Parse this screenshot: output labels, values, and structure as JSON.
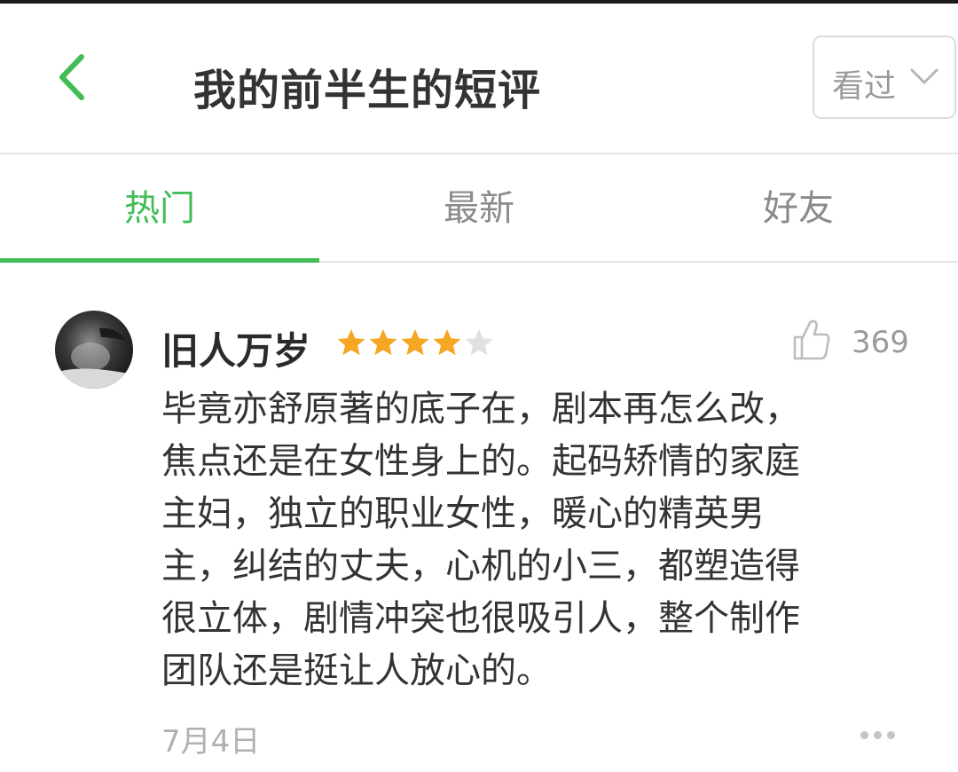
{
  "header": {
    "title": "我的前半生的短评",
    "filter_label": "看过",
    "back_icon": "chevron-left-icon",
    "filter_icon": "chevron-down-icon"
  },
  "tabs": [
    {
      "label": "热门",
      "active": true
    },
    {
      "label": "最新",
      "active": false
    },
    {
      "label": "好友",
      "active": false
    }
  ],
  "colors": {
    "accent": "#42bd56",
    "star": "#f5a623",
    "star_empty": "#e0e0e0"
  },
  "review": {
    "username": "旧人万岁",
    "rating": 4,
    "rating_max": 5,
    "likes": "369",
    "text_lines": [
      "毕竟亦舒原著的底子在，剧本再怎么改，",
      "焦点还是在女性身上的。起码矫情的家庭",
      "主妇，独立的职业女性，暖心的精英男",
      "主，纠结的丈夫，心机的小三，都塑造得",
      "很立体，剧情冲突也很吸引人，整个制作",
      "团队还是挺让人放心的。"
    ],
    "date": "7月4日"
  }
}
